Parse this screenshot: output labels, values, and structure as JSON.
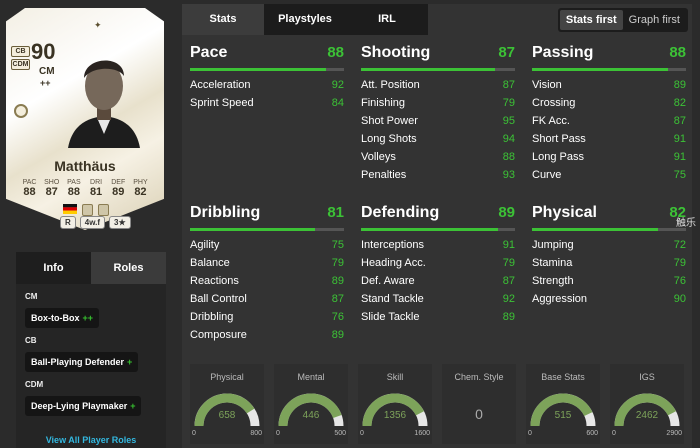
{
  "card": {
    "rating": "90",
    "position": "CM",
    "position_plus": "++",
    "alt_positions": [
      "CB",
      "CDM"
    ],
    "name": "Matthäus",
    "attributes": [
      {
        "label": "PAC",
        "value": "88"
      },
      {
        "label": "SHO",
        "value": "87"
      },
      {
        "label": "PAS",
        "value": "88"
      },
      {
        "label": "DRI",
        "value": "81"
      },
      {
        "label": "DEF",
        "value": "89"
      },
      {
        "label": "PHY",
        "value": "82"
      }
    ],
    "chips": {
      "foot": "R",
      "weak_foot": "4w.f",
      "skill": "3★"
    }
  },
  "side_tabs": {
    "info": "Info",
    "roles": "Roles"
  },
  "roles": [
    {
      "pos": "CM",
      "role": "Box-to-Box",
      "plus": "++"
    },
    {
      "pos": "CB",
      "role": "Ball-Playing Defender",
      "plus": "+"
    },
    {
      "pos": "CDM",
      "role": "Deep-Lying Playmaker",
      "plus": "+"
    }
  ],
  "view_all": "View All Player Roles",
  "tabs": [
    "Stats",
    "Playstyles",
    "IRL"
  ],
  "toggle": {
    "first": "Stats first",
    "second": "Graph first"
  },
  "stats": {
    "pace": {
      "title": "Pace",
      "value": "88",
      "rows": [
        {
          "label": "Acceleration",
          "value": "92"
        },
        {
          "label": "Sprint Speed",
          "value": "84"
        }
      ]
    },
    "shooting": {
      "title": "Shooting",
      "value": "87",
      "rows": [
        {
          "label": "Att. Position",
          "value": "87"
        },
        {
          "label": "Finishing",
          "value": "79"
        },
        {
          "label": "Shot Power",
          "value": "95"
        },
        {
          "label": "Long Shots",
          "value": "94"
        },
        {
          "label": "Volleys",
          "value": "88"
        },
        {
          "label": "Penalties",
          "value": "93"
        }
      ]
    },
    "passing": {
      "title": "Passing",
      "value": "88",
      "rows": [
        {
          "label": "Vision",
          "value": "89"
        },
        {
          "label": "Crossing",
          "value": "82"
        },
        {
          "label": "FK Acc.",
          "value": "87"
        },
        {
          "label": "Short Pass",
          "value": "91"
        },
        {
          "label": "Long Pass",
          "value": "91"
        },
        {
          "label": "Curve",
          "value": "75"
        }
      ]
    },
    "dribbling": {
      "title": "Dribbling",
      "value": "81",
      "rows": [
        {
          "label": "Agility",
          "value": "75"
        },
        {
          "label": "Balance",
          "value": "79"
        },
        {
          "label": "Reactions",
          "value": "89"
        },
        {
          "label": "Ball Control",
          "value": "87"
        },
        {
          "label": "Dribbling",
          "value": "76"
        },
        {
          "label": "Composure",
          "value": "89"
        }
      ]
    },
    "defending": {
      "title": "Defending",
      "value": "89",
      "rows": [
        {
          "label": "Interceptions",
          "value": "91"
        },
        {
          "label": "Heading Acc.",
          "value": "79"
        },
        {
          "label": "Def. Aware",
          "value": "87"
        },
        {
          "label": "Stand Tackle",
          "value": "92"
        },
        {
          "label": "Slide Tackle",
          "value": "89"
        }
      ]
    },
    "physical": {
      "title": "Physical",
      "value": "82",
      "rows": [
        {
          "label": "Jumping",
          "value": "72"
        },
        {
          "label": "Stamina",
          "value": "79"
        },
        {
          "label": "Strength",
          "value": "76"
        },
        {
          "label": "Aggression",
          "value": "90"
        }
      ]
    }
  },
  "gauges": [
    {
      "label": "Physical",
      "value": "658",
      "min": "0",
      "max": "800",
      "frac": 0.82
    },
    {
      "label": "Mental",
      "value": "446",
      "min": "0",
      "max": "500",
      "frac": 0.89
    },
    {
      "label": "Skill",
      "value": "1356",
      "min": "0",
      "max": "1600",
      "frac": 0.85
    },
    {
      "label": "Chem. Style",
      "value": "0"
    },
    {
      "label": "Base Stats",
      "value": "515",
      "min": "0",
      "max": "600",
      "frac": 0.86
    },
    {
      "label": "IGS",
      "value": "2462",
      "min": "0",
      "max": "2900",
      "frac": 0.85
    }
  ],
  "watermark": "触乐",
  "colors": {
    "green": "#3cc236",
    "accent_blue": "#33b8e0"
  }
}
